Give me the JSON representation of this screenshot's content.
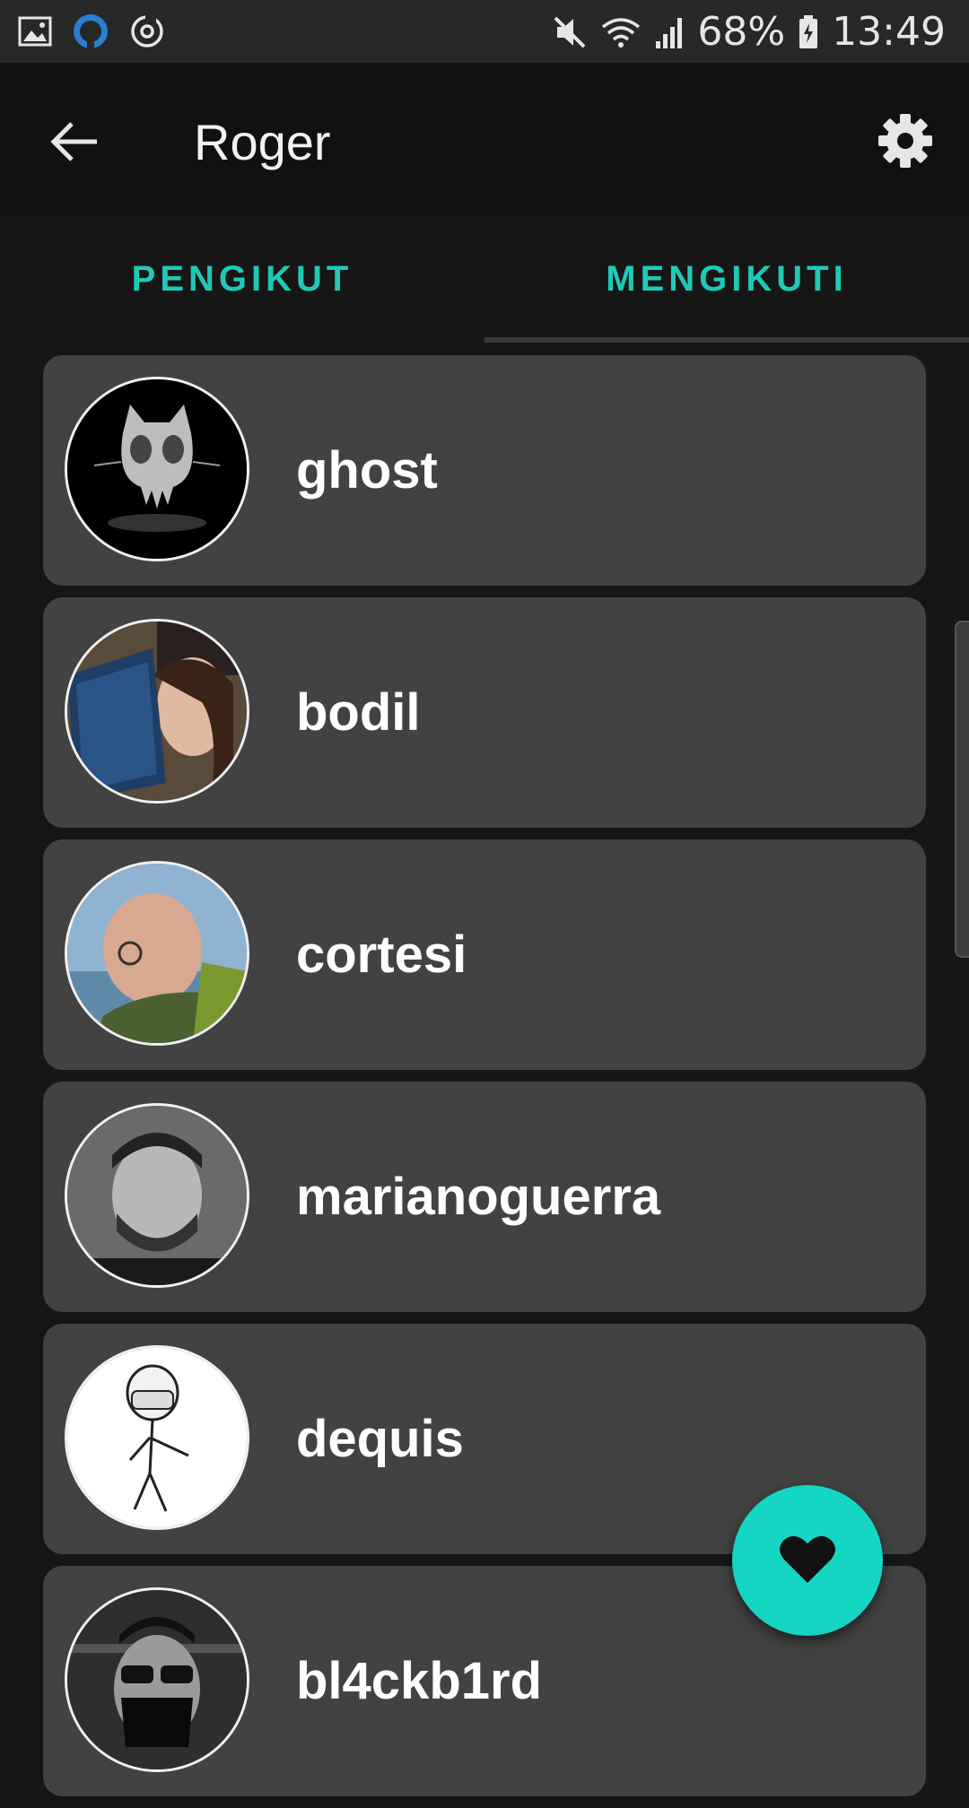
{
  "status_bar": {
    "battery": "68%",
    "time": "13:49",
    "icons": [
      "gallery-icon",
      "github-icon",
      "sync-icon",
      "mute-icon",
      "wifi-icon",
      "signal-icon",
      "battery-icon"
    ]
  },
  "app_bar": {
    "title": "Roger",
    "back_icon": "arrow-left-icon",
    "settings_icon": "gear-icon"
  },
  "tabs": [
    {
      "label": "PENGIKUT",
      "selected": false
    },
    {
      "label": "MENGIKUTI",
      "selected": true
    }
  ],
  "users": [
    {
      "name": "ghost"
    },
    {
      "name": "bodil"
    },
    {
      "name": "cortesi"
    },
    {
      "name": "marianoguerra"
    },
    {
      "name": "dequis"
    },
    {
      "name": "bl4ckb1rd"
    }
  ],
  "fab": {
    "icon": "heart-icon"
  },
  "colors": {
    "accent": "#1fc9b7",
    "card": "#424242",
    "background": "#161616",
    "appbar": "#111111"
  }
}
